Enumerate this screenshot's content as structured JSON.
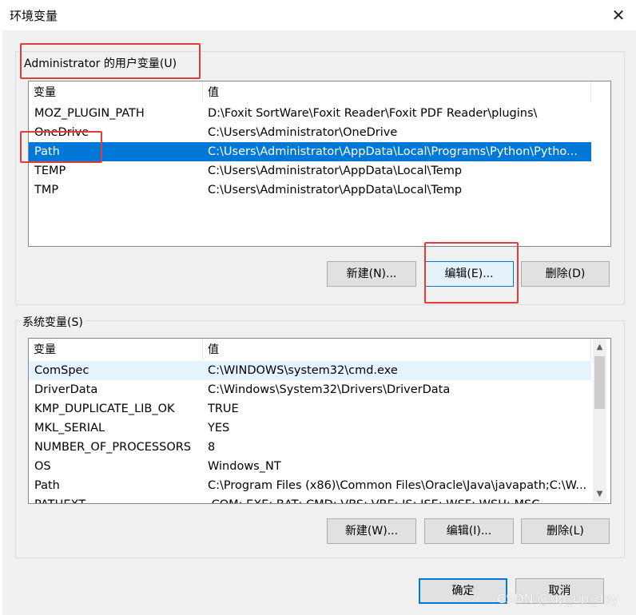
{
  "window": {
    "title": "环境变量",
    "close_glyph": "✕"
  },
  "user_section": {
    "title": "Administrator 的用户变量(U)",
    "columns": [
      "变量",
      "值"
    ],
    "rows": [
      {
        "name": "MOZ_PLUGIN_PATH",
        "value": "D:\\Foxit SortWare\\Foxit Reader\\Foxit PDF Reader\\plugins\\"
      },
      {
        "name": "OneDrive",
        "value": "C:\\Users\\Administrator\\OneDrive"
      },
      {
        "name": "Path",
        "value": "C:\\Users\\Administrator\\AppData\\Local\\Programs\\Python\\Pytho..."
      },
      {
        "name": "TEMP",
        "value": "C:\\Users\\Administrator\\AppData\\Local\\Temp"
      },
      {
        "name": "TMP",
        "value": "C:\\Users\\Administrator\\AppData\\Local\\Temp"
      }
    ],
    "selected": "Path",
    "buttons": {
      "new": "新建(N)...",
      "edit": "编辑(E)...",
      "delete": "删除(D)"
    }
  },
  "system_section": {
    "title": "系统变量(S)",
    "columns": [
      "变量",
      "值"
    ],
    "rows": [
      {
        "name": "ComSpec",
        "value": "C:\\WINDOWS\\system32\\cmd.exe"
      },
      {
        "name": "DriverData",
        "value": "C:\\Windows\\System32\\Drivers\\DriverData"
      },
      {
        "name": "KMP_DUPLICATE_LIB_OK",
        "value": "TRUE"
      },
      {
        "name": "MKL_SERIAL",
        "value": "YES"
      },
      {
        "name": "NUMBER_OF_PROCESSORS",
        "value": "8"
      },
      {
        "name": "OS",
        "value": "Windows_NT"
      },
      {
        "name": "Path",
        "value": "C:\\Program Files (x86)\\Common Files\\Oracle\\Java\\javapath;C:\\W..."
      },
      {
        "name": "PATHEXT",
        "value": ".COM;.EXE;.BAT;.CMD;.VBS;.VBE;.JS;.JSE;.WSF;.WSH;.MSC"
      }
    ],
    "hover": "ComSpec",
    "buttons": {
      "new": "新建(W)...",
      "edit": "编辑(I)...",
      "delete": "删除(L)"
    },
    "scroll": {
      "up_glyph": "▲",
      "down_glyph": "▼"
    }
  },
  "footer": {
    "ok": "确定",
    "cancel": "取消"
  },
  "watermark": "CSDN @up_up_day",
  "colors": {
    "selection": "#0078d7",
    "annotation": "#e03c3c"
  }
}
